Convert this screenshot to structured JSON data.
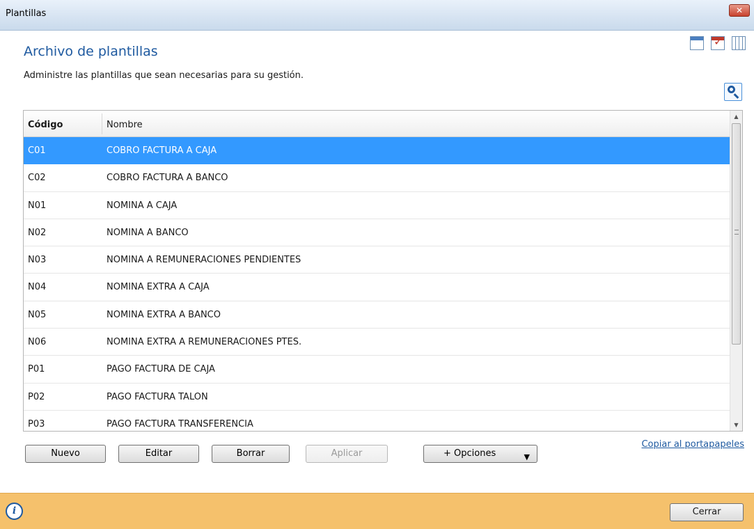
{
  "window": {
    "title": "Plantillas",
    "close_glyph": "✕"
  },
  "page": {
    "heading": "Archivo de plantillas",
    "subtitle": "Administre las plantillas que sean necesarias para su gestión."
  },
  "icons": {
    "top": [
      "calendar-icon",
      "task-check-icon",
      "grid-calendar-icon"
    ],
    "search": "search-icon",
    "info": "info-icon",
    "info_glyph": "i"
  },
  "table": {
    "columns": [
      "Código",
      "Nombre"
    ],
    "selected_index": 0,
    "rows": [
      {
        "code": "C01",
        "name": "COBRO FACTURA A CAJA"
      },
      {
        "code": "C02",
        "name": "COBRO FACTURA A BANCO"
      },
      {
        "code": "N01",
        "name": "NOMINA A CAJA"
      },
      {
        "code": "N02",
        "name": "NOMINA A BANCO"
      },
      {
        "code": "N03",
        "name": "NOMINA A REMUNERACIONES PENDIENTES"
      },
      {
        "code": "N04",
        "name": "NOMINA EXTRA A CAJA"
      },
      {
        "code": "N05",
        "name": "NOMINA EXTRA A BANCO"
      },
      {
        "code": "N06",
        "name": "NOMINA EXTRA A REMUNERACIONES PTES."
      },
      {
        "code": "P01",
        "name": "PAGO FACTURA DE CAJA"
      },
      {
        "code": "P02",
        "name": "PAGO FACTURA TALON"
      },
      {
        "code": "P03",
        "name": "PAGO FACTURA TRANSFERENCIA"
      }
    ]
  },
  "buttons": {
    "new": "Nuevo",
    "edit": "Editar",
    "delete": "Borrar",
    "apply": "Aplicar",
    "options": "+ Opciones",
    "copy_link": "Copiar al portapapeles",
    "close": "Cerrar"
  }
}
